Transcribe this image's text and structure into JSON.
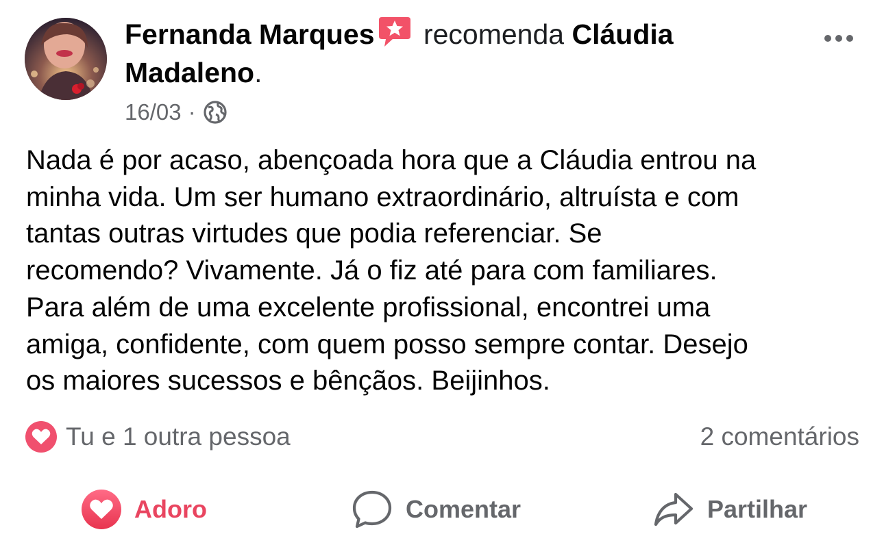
{
  "header": {
    "author": "Fernanda Marques",
    "action_text": "recomenda",
    "recommended_line1": "Cláudia",
    "recommended_line2": "Madaleno",
    "period": ".",
    "date": "16/03",
    "separator": "·",
    "privacy_icon": "globe-icon",
    "recommend_icon": "recommend-star-icon",
    "more_icon": "more-horizontal-icon"
  },
  "post": {
    "lines": [
      "Nada é por acaso, abençoada hora que a Cláudia entrou na",
      "minha vida. Um ser humano extraordinário, altruísta e com",
      "tantas outras virtudes que podia referenciar. Se",
      "recomendo? Vivamente. Já o fiz até para com familiares.",
      "Para além de uma excelente profissional, encontrei uma",
      "amiga, confidente, com quem posso sempre contar. Desejo",
      "os maiores sucessos e bênçãos. Beijinhos."
    ]
  },
  "summary": {
    "reaction_icon": "heart-icon",
    "reactions_text": "Tu e 1 outra pessoa",
    "comments_text": "2 comentários"
  },
  "actions": {
    "love_label": "Adoro",
    "comment_label": "Comentar",
    "share_label": "Partilhar"
  },
  "colors": {
    "love": "#e94560",
    "secondary_text": "#65676b",
    "recommend_badge": "#f25268"
  }
}
